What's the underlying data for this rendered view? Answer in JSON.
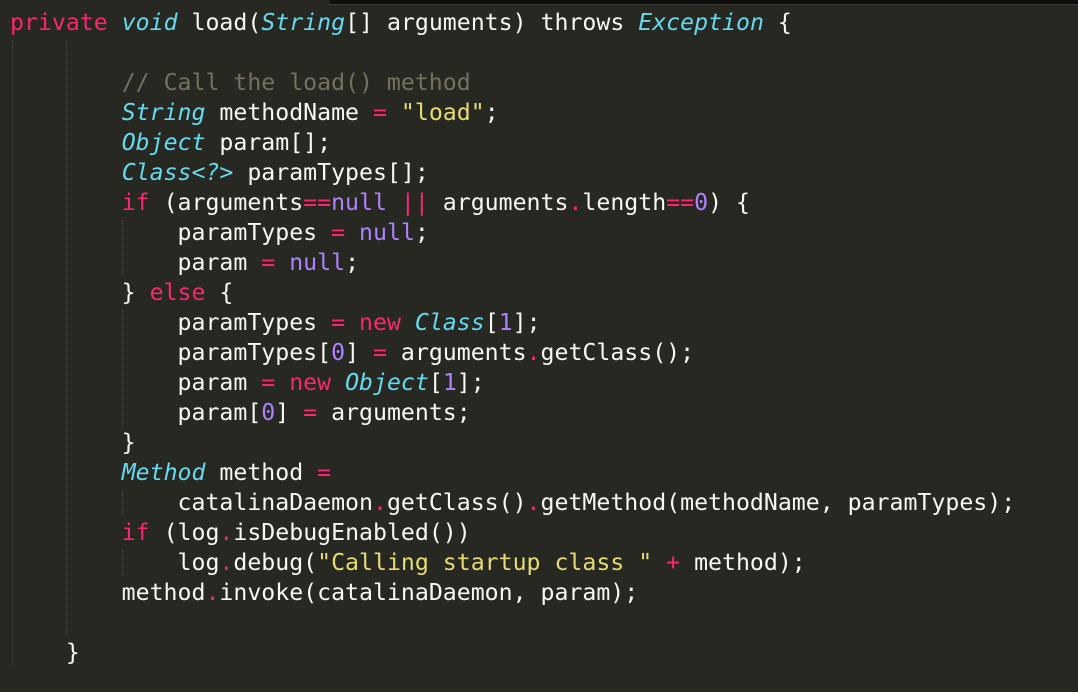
{
  "editor": {
    "theme_colors": {
      "background": "#272822",
      "keyword": "#f92672",
      "type": "#66d9ef",
      "string": "#e6db74",
      "number": "#ae81ff",
      "comment": "#75715e",
      "text": "#f8f8f2"
    },
    "cursor": {
      "line": 1,
      "before_token": 13
    },
    "lines": [
      [
        [
          "k",
          "private"
        ],
        [
          "p",
          " "
        ],
        [
          "ty",
          "void"
        ],
        [
          "p",
          " load("
        ],
        [
          "ty",
          "String"
        ],
        [
          "p",
          "[] arguments) "
        ],
        [
          "p",
          "throws"
        ],
        [
          "p",
          " "
        ],
        [
          "ty",
          "Exception"
        ],
        [
          "p",
          " {"
        ]
      ],
      [],
      [
        [
          "p",
          "        "
        ],
        [
          "c",
          "// Call the load() method"
        ]
      ],
      [
        [
          "p",
          "        "
        ],
        [
          "ty",
          "String"
        ],
        [
          "p",
          " methodName "
        ],
        [
          "op",
          "="
        ],
        [
          "p",
          " "
        ],
        [
          "s",
          "\"load\""
        ],
        [
          "p",
          ";"
        ]
      ],
      [
        [
          "p",
          "        "
        ],
        [
          "ty",
          "Object"
        ],
        [
          "p",
          " param[];"
        ]
      ],
      [
        [
          "p",
          "        "
        ],
        [
          "ty",
          "Class<?>"
        ],
        [
          "p",
          " paramTypes[];"
        ]
      ],
      [
        [
          "p",
          "        "
        ],
        [
          "k",
          "if"
        ],
        [
          "p",
          " (arguments"
        ],
        [
          "op",
          "=="
        ],
        [
          "n",
          "null"
        ],
        [
          "p",
          " "
        ],
        [
          "op",
          "||"
        ],
        [
          "p",
          " arguments"
        ],
        [
          "op",
          "."
        ],
        [
          "p",
          "length"
        ],
        [
          "op",
          "=="
        ],
        [
          "n",
          "0"
        ],
        [
          "p",
          ") {"
        ]
      ],
      [
        [
          "p",
          "            paramTypes "
        ],
        [
          "op",
          "="
        ],
        [
          "p",
          " "
        ],
        [
          "n",
          "null"
        ],
        [
          "p",
          ";"
        ]
      ],
      [
        [
          "p",
          "            param "
        ],
        [
          "op",
          "="
        ],
        [
          "p",
          " "
        ],
        [
          "n",
          "null"
        ],
        [
          "p",
          ";"
        ]
      ],
      [
        [
          "p",
          "        } "
        ],
        [
          "k",
          "else"
        ],
        [
          "p",
          " {"
        ]
      ],
      [
        [
          "p",
          "            paramTypes "
        ],
        [
          "op",
          "="
        ],
        [
          "p",
          " "
        ],
        [
          "k",
          "new"
        ],
        [
          "p",
          " "
        ],
        [
          "ty",
          "Class"
        ],
        [
          "p",
          "["
        ],
        [
          "n",
          "1"
        ],
        [
          "p",
          "];"
        ]
      ],
      [
        [
          "p",
          "            paramTypes["
        ],
        [
          "n",
          "0"
        ],
        [
          "p",
          "] "
        ],
        [
          "op",
          "="
        ],
        [
          "p",
          " arguments"
        ],
        [
          "op",
          "."
        ],
        [
          "p",
          "getClass();"
        ]
      ],
      [
        [
          "p",
          "            param "
        ],
        [
          "op",
          "="
        ],
        [
          "p",
          " "
        ],
        [
          "k",
          "new"
        ],
        [
          "p",
          " "
        ],
        [
          "ty",
          "Object"
        ],
        [
          "p",
          "["
        ],
        [
          "n",
          "1"
        ],
        [
          "p",
          "];"
        ]
      ],
      [
        [
          "p",
          "            param["
        ],
        [
          "n",
          "0"
        ],
        [
          "p",
          "] "
        ],
        [
          "op",
          "="
        ],
        [
          "p",
          " arguments;"
        ]
      ],
      [
        [
          "p",
          "        }"
        ]
      ],
      [
        [
          "p",
          "        "
        ],
        [
          "ty",
          "Method"
        ],
        [
          "p",
          " method "
        ],
        [
          "op",
          "="
        ]
      ],
      [
        [
          "p",
          "            catalinaDaemon"
        ],
        [
          "op",
          "."
        ],
        [
          "p",
          "getClass()"
        ],
        [
          "op",
          "."
        ],
        [
          "p",
          "getMethod(methodName, paramTypes);"
        ]
      ],
      [
        [
          "p",
          "        "
        ],
        [
          "k",
          "if"
        ],
        [
          "p",
          " (log"
        ],
        [
          "op",
          "."
        ],
        [
          "p",
          "isDebugEnabled())"
        ]
      ],
      [
        [
          "p",
          "            log"
        ],
        [
          "op",
          "."
        ],
        [
          "p",
          "debug("
        ],
        [
          "s",
          "\"Calling startup class \""
        ],
        [
          "p",
          " "
        ],
        [
          "op",
          "+"
        ],
        [
          "p",
          " method);"
        ]
      ],
      [
        [
          "p",
          "        method"
        ],
        [
          "op",
          "."
        ],
        [
          "p",
          "invoke(catalinaDaemon, param);"
        ]
      ],
      [],
      [
        [
          "p",
          "    }"
        ]
      ]
    ]
  }
}
